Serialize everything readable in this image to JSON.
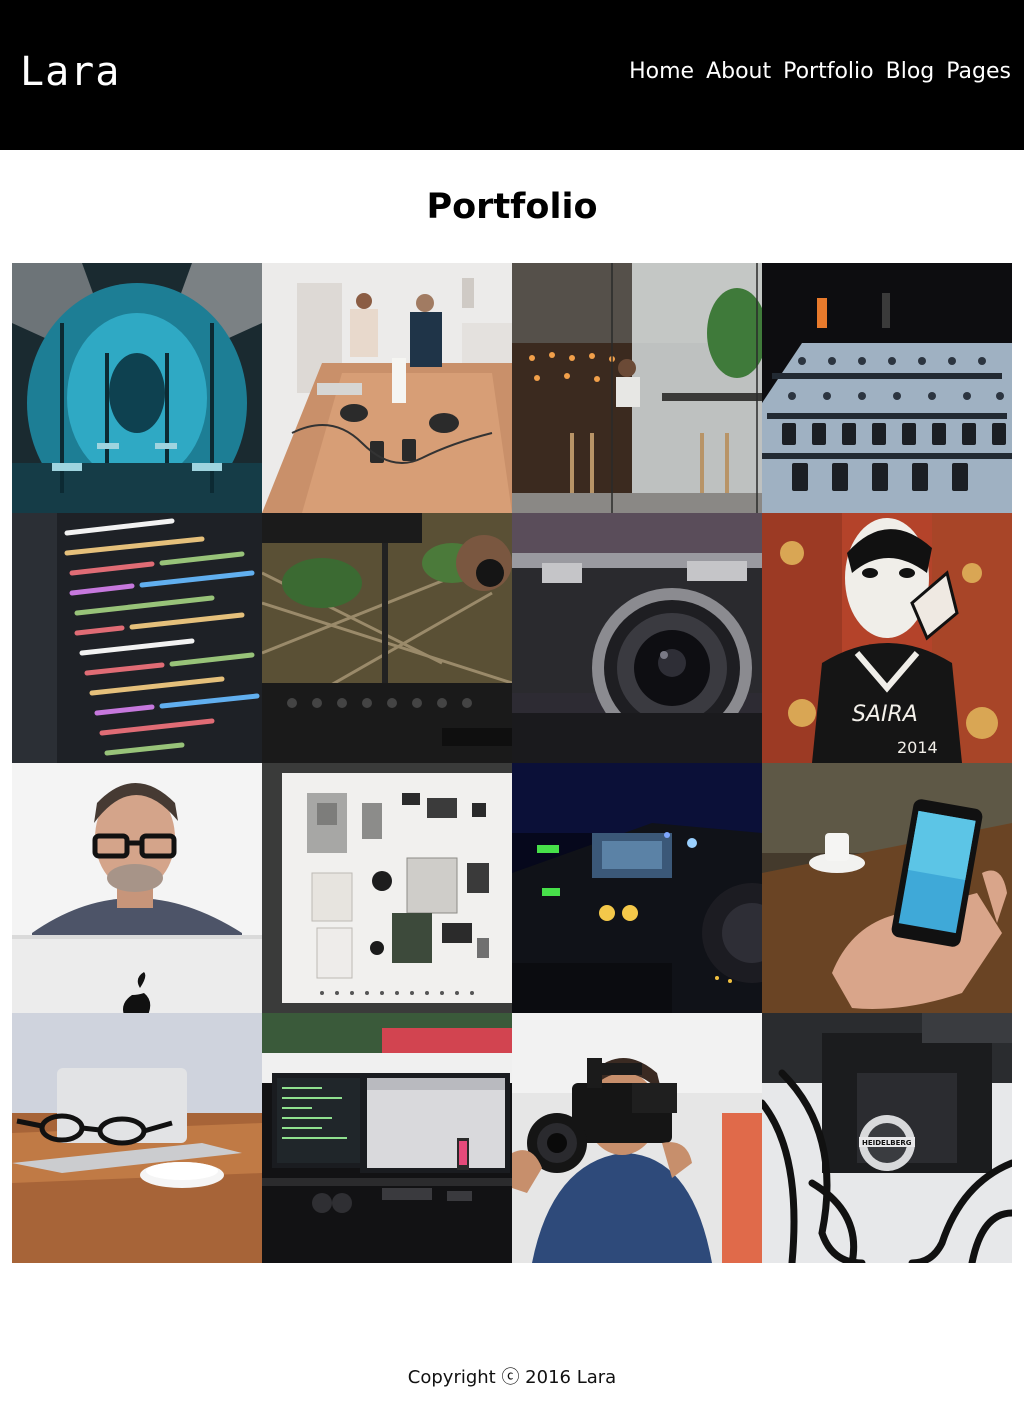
{
  "header": {
    "brand": "Lara",
    "nav": [
      {
        "label": "Home"
      },
      {
        "label": "About"
      },
      {
        "label": "Portfolio"
      },
      {
        "label": "Blog"
      },
      {
        "label": "Pages"
      }
    ]
  },
  "main": {
    "title": "Portfolio"
  },
  "footer": {
    "copyright": "Copyright ⓒ 2016 Lara"
  },
  "colors": {
    "header_bg": "#000000",
    "header_text": "#ffffff",
    "page_bg": "#ffffff"
  }
}
